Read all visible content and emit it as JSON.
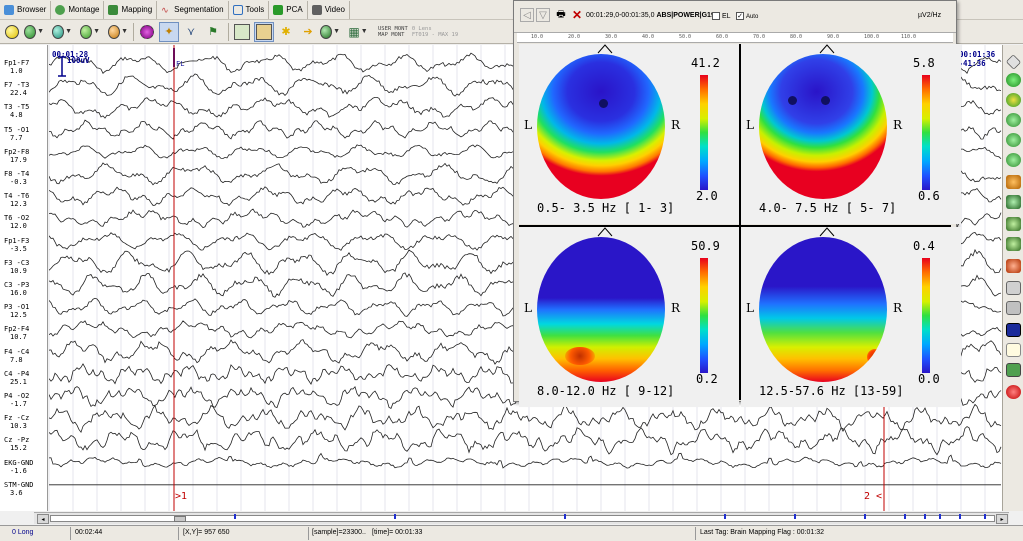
{
  "menubar": {
    "tabs": [
      {
        "label": "Browser",
        "icon": "browser-icon",
        "color": "#4a8fd8"
      },
      {
        "label": "Montage",
        "icon": "montage-icon",
        "color": "#4ea04e"
      },
      {
        "label": "Mapping",
        "icon": "mapping-icon",
        "color": "#3b8b3b"
      },
      {
        "label": "Segmentation",
        "icon": "segmentation-icon",
        "color": "#c04040"
      },
      {
        "label": "Tools",
        "icon": "tools-icon",
        "color": "#3070c0"
      },
      {
        "label": "PCA",
        "icon": "pca-icon",
        "color": "#2a9a2a"
      },
      {
        "label": "Video",
        "icon": "video-icon",
        "color": "#606060"
      }
    ]
  },
  "toolbar": {
    "user_mont": "USER MONT",
    "map_mont": "MAP MONT",
    "zero_lens": "0 Lens",
    "filter": "FT019 - MAX 19"
  },
  "channels": [
    {
      "name": "Fp1-F7",
      "value": "1.0"
    },
    {
      "name": "F7 -T3",
      "value": "22.4"
    },
    {
      "name": "T3 -T5",
      "value": "4.8"
    },
    {
      "name": "T5 -O1",
      "value": "7.7"
    },
    {
      "name": "Fp2-F8",
      "value": "17.9"
    },
    {
      "name": "F8 -T4",
      "value": "-0.3"
    },
    {
      "name": "T4 -T6",
      "value": "12.3"
    },
    {
      "name": "T6 -O2",
      "value": "12.0"
    },
    {
      "name": "Fp1-F3",
      "value": "-3.5"
    },
    {
      "name": "F3 -C3",
      "value": "10.9"
    },
    {
      "name": "C3 -P3",
      "value": "16.0"
    },
    {
      "name": "P3 -O1",
      "value": "12.5"
    },
    {
      "name": "Fp2-F4",
      "value": "10.7"
    },
    {
      "name": "F4 -C4",
      "value": "7.8"
    },
    {
      "name": "C4 -P4",
      "value": "25.1"
    },
    {
      "name": "P4 -O2",
      "value": "-1.7"
    },
    {
      "name": "Fz -Cz",
      "value": "10.3"
    },
    {
      "name": "Cz -Pz",
      "value": "15.2"
    },
    {
      "name": "EKG-GND",
      "value": "-1.6"
    },
    {
      "name": "STM-GND",
      "value": "3.6"
    }
  ],
  "eeg": {
    "start_time": "00:01:28",
    "scale": "100uV",
    "end_time_top": "00:01:36",
    "end_time_bottom": "0-41:36",
    "marker_left_label": ">1",
    "marker_right_label": "2 <",
    "marker_tag": "FL"
  },
  "mapping": {
    "time_range": "00:01:29,0-00:01:35,0",
    "mode": "ABS|POWER|G19",
    "el_label": "EL",
    "auto_label": "Auto",
    "auto_checked": true,
    "unit": "µV2/Hz",
    "ruler_ticks": [
      "10.0",
      "20.0",
      "30.0",
      "40.0",
      "50.0",
      "60.0",
      "70.0",
      "80.0",
      "90.0",
      "100.0",
      "110.0"
    ],
    "left_label": "L",
    "right_label": "R",
    "maps": [
      {
        "max": "41.2",
        "min": "2.0",
        "band": "0.5- 3.5 Hz [ 1- 3]"
      },
      {
        "max": "5.8",
        "min": "0.6",
        "band": "4.0- 7.5 Hz [ 5- 7]"
      },
      {
        "max": "50.9",
        "min": "0.2",
        "band": "8.0-12.0 Hz [ 9-12]"
      },
      {
        "max": "0.4",
        "min": "0.0",
        "band": "12.5-57.6 Hz [13-59]"
      }
    ]
  },
  "status": {
    "long": "0 Long",
    "duration": "00:02:44",
    "xy": "[X,Y]=  957  650",
    "sample": "[sample]=23300..",
    "time": "[time]= 00:01:33",
    "last_tag": "Last Tag:  Brain Mapping Flag : 00:01:32"
  }
}
